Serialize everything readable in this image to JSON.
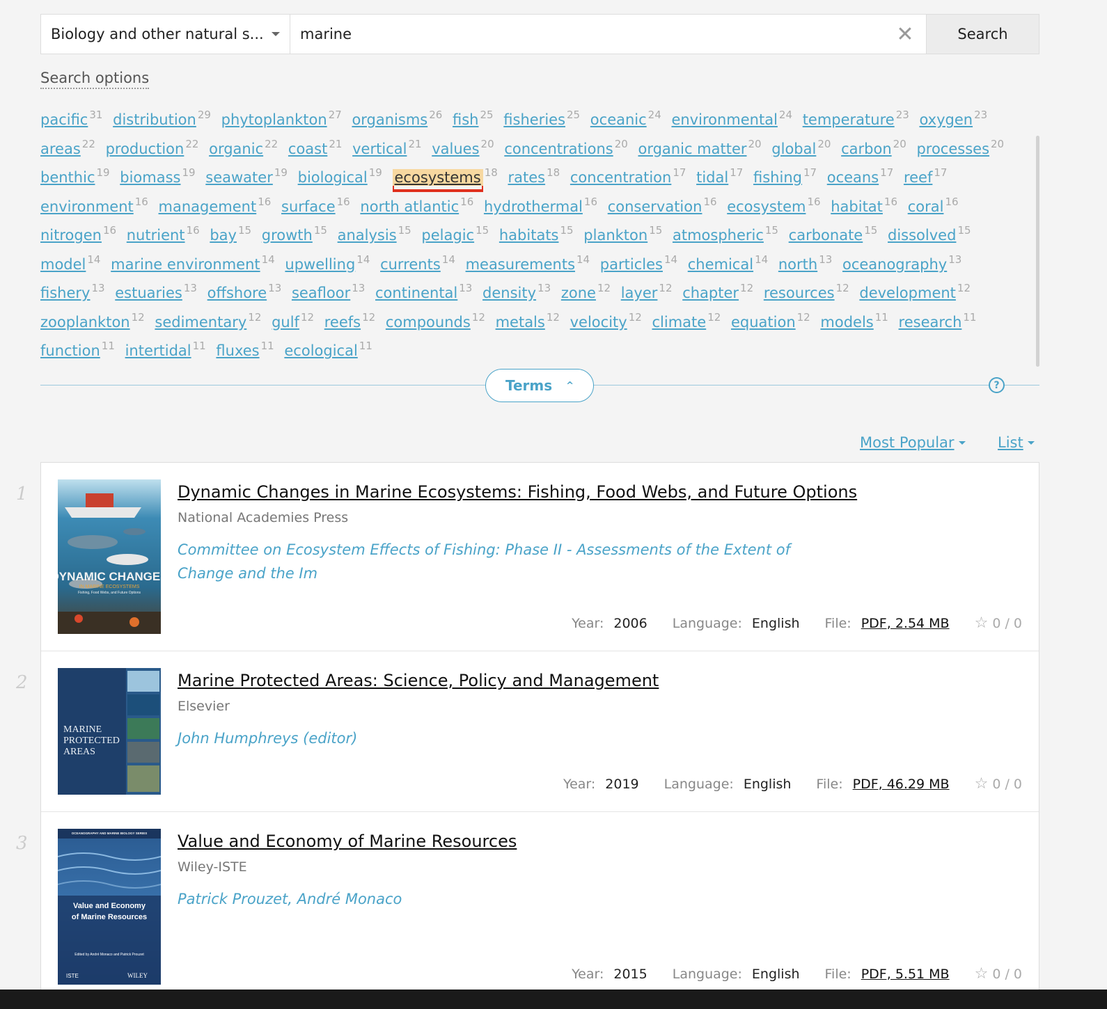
{
  "search": {
    "category": "Biology and other natural s...",
    "query": "marine",
    "clear_icon": "✕",
    "button_label": "Search",
    "options_label": "Search options"
  },
  "terms": [
    {
      "term": "pacific",
      "count": "31"
    },
    {
      "term": "distribution",
      "count": "29"
    },
    {
      "term": "phytoplankton",
      "count": "27"
    },
    {
      "term": "organisms",
      "count": "26"
    },
    {
      "term": "fish",
      "count": "25"
    },
    {
      "term": "fisheries",
      "count": "25"
    },
    {
      "term": "oceanic",
      "count": "24"
    },
    {
      "term": "environmental",
      "count": "24"
    },
    {
      "term": "temperature",
      "count": "23"
    },
    {
      "term": "oxygen",
      "count": "23"
    },
    {
      "term": "areas",
      "count": "22"
    },
    {
      "term": "production",
      "count": "22"
    },
    {
      "term": "organic",
      "count": "22"
    },
    {
      "term": "coast",
      "count": "21"
    },
    {
      "term": "vertical",
      "count": "21"
    },
    {
      "term": "values",
      "count": "20"
    },
    {
      "term": "concentrations",
      "count": "20"
    },
    {
      "term": "organic matter",
      "count": "20"
    },
    {
      "term": "global",
      "count": "20"
    },
    {
      "term": "carbon",
      "count": "20"
    },
    {
      "term": "processes",
      "count": "20"
    },
    {
      "term": "benthic",
      "count": "19"
    },
    {
      "term": "biomass",
      "count": "19"
    },
    {
      "term": "seawater",
      "count": "19"
    },
    {
      "term": "biological",
      "count": "19"
    },
    {
      "term": "ecosystems",
      "count": "18",
      "highlighted": true
    },
    {
      "term": "rates",
      "count": "18"
    },
    {
      "term": "concentration",
      "count": "17"
    },
    {
      "term": "tidal",
      "count": "17"
    },
    {
      "term": "fishing",
      "count": "17"
    },
    {
      "term": "oceans",
      "count": "17"
    },
    {
      "term": "reef",
      "count": "17"
    },
    {
      "term": "environment",
      "count": "16"
    },
    {
      "term": "management",
      "count": "16"
    },
    {
      "term": "surface",
      "count": "16"
    },
    {
      "term": "north atlantic",
      "count": "16"
    },
    {
      "term": "hydrothermal",
      "count": "16"
    },
    {
      "term": "conservation",
      "count": "16"
    },
    {
      "term": "ecosystem",
      "count": "16"
    },
    {
      "term": "habitat",
      "count": "16"
    },
    {
      "term": "coral",
      "count": "16"
    },
    {
      "term": "nitrogen",
      "count": "16"
    },
    {
      "term": "nutrient",
      "count": "16"
    },
    {
      "term": "bay",
      "count": "15"
    },
    {
      "term": "growth",
      "count": "15"
    },
    {
      "term": "analysis",
      "count": "15"
    },
    {
      "term": "pelagic",
      "count": "15"
    },
    {
      "term": "habitats",
      "count": "15"
    },
    {
      "term": "plankton",
      "count": "15"
    },
    {
      "term": "atmospheric",
      "count": "15"
    },
    {
      "term": "carbonate",
      "count": "15"
    },
    {
      "term": "dissolved",
      "count": "15"
    },
    {
      "term": "model",
      "count": "14"
    },
    {
      "term": "marine environment",
      "count": "14"
    },
    {
      "term": "upwelling",
      "count": "14"
    },
    {
      "term": "currents",
      "count": "14"
    },
    {
      "term": "measurements",
      "count": "14"
    },
    {
      "term": "particles",
      "count": "14"
    },
    {
      "term": "chemical",
      "count": "14"
    },
    {
      "term": "north",
      "count": "13"
    },
    {
      "term": "oceanography",
      "count": "13"
    },
    {
      "term": "fishery",
      "count": "13"
    },
    {
      "term": "estuaries",
      "count": "13"
    },
    {
      "term": "offshore",
      "count": "13"
    },
    {
      "term": "seafloor",
      "count": "13"
    },
    {
      "term": "continental",
      "count": "13"
    },
    {
      "term": "density",
      "count": "13"
    },
    {
      "term": "zone",
      "count": "12"
    },
    {
      "term": "layer",
      "count": "12"
    },
    {
      "term": "chapter",
      "count": "12"
    },
    {
      "term": "resources",
      "count": "12"
    },
    {
      "term": "development",
      "count": "12"
    },
    {
      "term": "zooplankton",
      "count": "12"
    },
    {
      "term": "sedimentary",
      "count": "12"
    },
    {
      "term": "gulf",
      "count": "12"
    },
    {
      "term": "reefs",
      "count": "12"
    },
    {
      "term": "compounds",
      "count": "12"
    },
    {
      "term": "metals",
      "count": "12"
    },
    {
      "term": "velocity",
      "count": "12"
    },
    {
      "term": "climate",
      "count": "12"
    },
    {
      "term": "equation",
      "count": "12"
    },
    {
      "term": "models",
      "count": "11"
    },
    {
      "term": "research",
      "count": "11"
    },
    {
      "term": "function",
      "count": "11"
    },
    {
      "term": "intertidal",
      "count": "11"
    },
    {
      "term": "fluxes",
      "count": "11"
    },
    {
      "term": "ecological",
      "count": "11"
    }
  ],
  "terms_toggle": {
    "label": "Terms",
    "chevron": "^",
    "help": "?"
  },
  "sort": {
    "label": "Most Popular",
    "view": "List"
  },
  "results": [
    {
      "num": "1",
      "title": "Dynamic Changes in Marine Ecosystems: Fishing, Food Webs, and Future Options",
      "publisher": "National Academies Press",
      "authors": "Committee on Ecosystem Effects of Fishing: Phase II - Assessments of the Extent of Change and the Im",
      "year_label": "Year:",
      "year": "2006",
      "language_label": "Language:",
      "language": "English",
      "file_label": "File:",
      "file": "PDF, 2.54 MB",
      "rating": "0 / 0",
      "cover": {
        "line1": "DYNAMIC CHANGES",
        "line2": "IN MARINE ECOSYSTEMS",
        "line3": "Fishing, Food Webs, and Future Options"
      }
    },
    {
      "num": "2",
      "title": "Marine Protected Areas: Science, Policy and Management",
      "publisher": "Elsevier",
      "authors": "John Humphreys (editor)",
      "year_label": "Year:",
      "year": "2019",
      "language_label": "Language:",
      "language": "English",
      "file_label": "File:",
      "file": "PDF, 46.29 MB",
      "rating": "0 / 0",
      "cover": {
        "line1": "MARINE",
        "line2": "PROTECTED",
        "line3": "AREAS"
      }
    },
    {
      "num": "3",
      "title": "Value and Economy of Marine Resources",
      "publisher": "Wiley-ISTE",
      "authors": "Patrick Prouzet, André Monaco",
      "year_label": "Year:",
      "year": "2015",
      "language_label": "Language:",
      "language": "English",
      "file_label": "File:",
      "file": "PDF, 5.51 MB",
      "rating": "0 / 0",
      "cover": {
        "series": "OCEANOGRAPHY AND MARINE BIOLOGY SERIES",
        "line1": "Value and Economy",
        "line2": "of Marine Resources",
        "editors": "Edited by André Monaco and Patrick Prouzet",
        "pub_left": "ISTE",
        "pub_right": "WILEY"
      }
    }
  ],
  "colors": {
    "accent": "#4aa3c8",
    "highlight_bg": "#f7d8a0",
    "highlight_underline": "#e0301e"
  },
  "icons": {
    "clear": "close-icon",
    "star": "star-icon",
    "help": "help-icon"
  }
}
